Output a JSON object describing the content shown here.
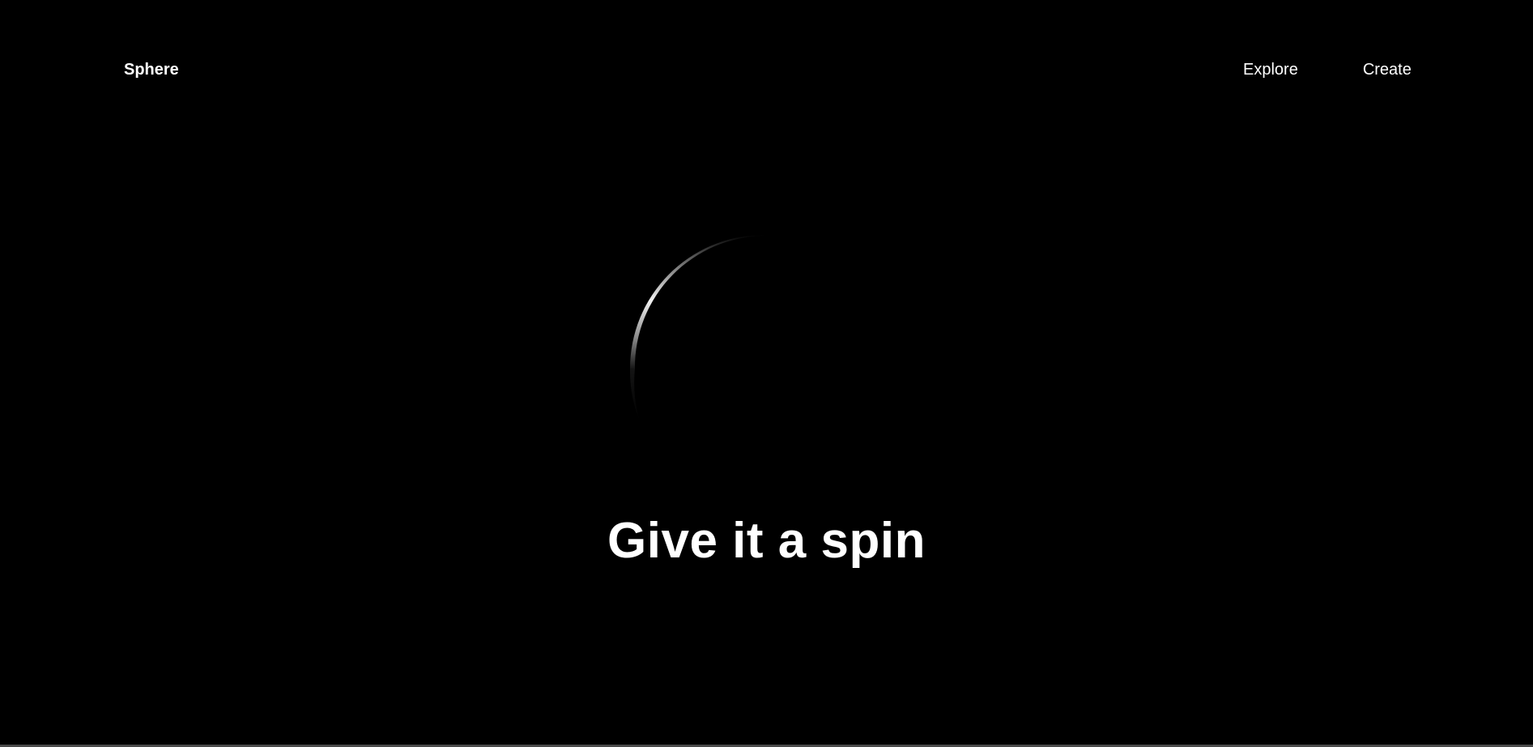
{
  "header": {
    "brand": "Sphere",
    "nav": [
      {
        "label": "Explore"
      },
      {
        "label": "Create"
      }
    ]
  },
  "hero": {
    "title": "Give it a spin",
    "sphere_icon": "sphere-crescent-graphic"
  },
  "colors": {
    "background": "#000000",
    "text": "#ffffff",
    "sphere_edge": "#ffffff"
  }
}
